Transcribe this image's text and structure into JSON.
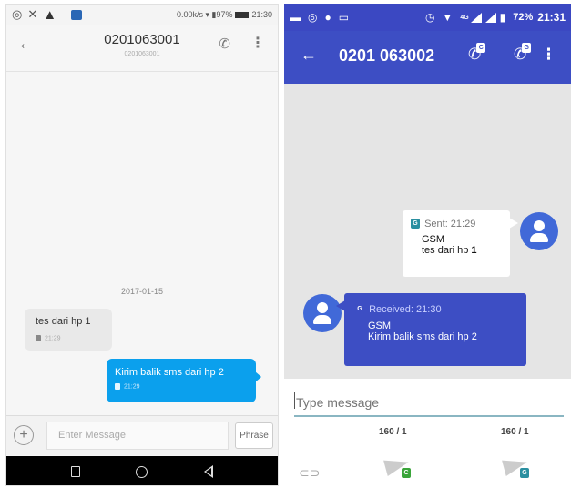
{
  "left_phone": {
    "status_bar": {
      "speed": "0.00k/s",
      "battery": "97%",
      "time": "21:30"
    },
    "header": {
      "title": "0201063001",
      "subtitle": "0201063001"
    },
    "date": "2017-01-15",
    "incoming": {
      "text": "tes dari hp 1",
      "time": "21:29"
    },
    "outgoing": {
      "text": "Kirim balik sms dari hp 2",
      "time": "21:29"
    },
    "compose": {
      "placeholder": "Enter Message",
      "phrase_label": "Phrase"
    }
  },
  "right_phone": {
    "status_bar": {
      "network": "4G",
      "battery": "72%",
      "time": "21:31"
    },
    "header": {
      "title": "0201 063002",
      "sim1_badge": "C",
      "sim2_badge": "G"
    },
    "sent_message": {
      "sim_badge": "G",
      "meta": "Sent: 21:29",
      "line1": "GSM",
      "line2": "tes dari hp ",
      "line2_bold": "1"
    },
    "received_message": {
      "sim_badge": "G",
      "meta": "Received: 21:30",
      "line1": "GSM",
      "line2": "Kirim balik sms dari hp 2"
    },
    "compose": {
      "placeholder": "Type message",
      "sim1_count": "160 / 1",
      "sim2_count": "160 / 1",
      "sim1_badge": "C",
      "sim2_badge": "G"
    }
  },
  "icons": [
    "whatsapp-icon",
    "missed-call-icon",
    "warning-icon",
    "wifi-icon",
    "battery-icon",
    "back-arrow-icon",
    "phone-icon",
    "more-vert-icon",
    "attach-icon",
    "send-icon",
    "person-icon"
  ],
  "colors": {
    "left_bubble_out": "#0ba0ed",
    "right_primary": "#3d4ec4",
    "right_status": "#3b48c2"
  }
}
